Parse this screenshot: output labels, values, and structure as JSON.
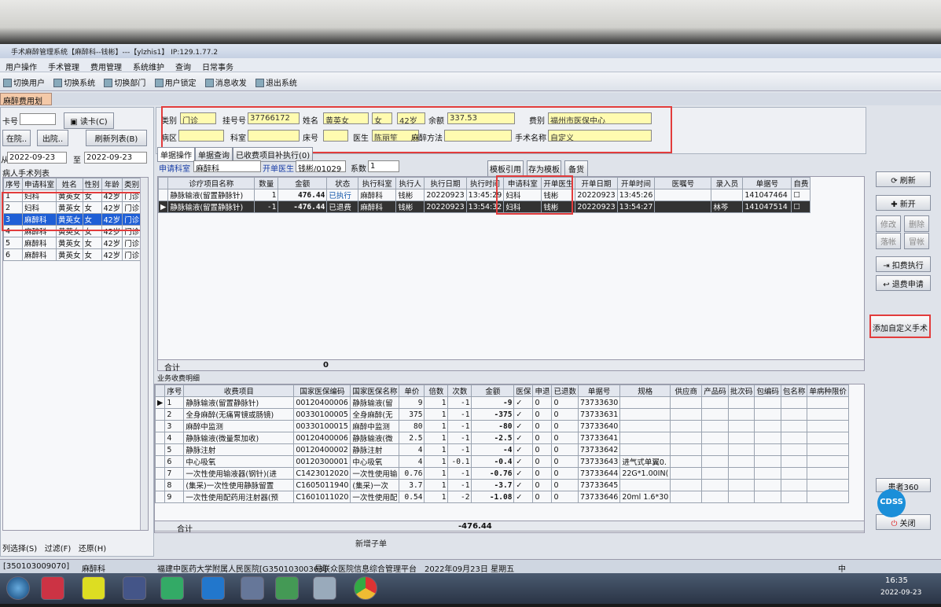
{
  "window": {
    "title": "手术麻醉管理系统【麻醉科--钱彬】---【ylzhis1】 IP:129.1.77.2"
  },
  "menu": [
    "用户操作",
    "手术管理",
    "费用管理",
    "系统维护",
    "查询",
    "日常事务"
  ],
  "toolbar": [
    "切换用户",
    "切换系统",
    "切换部门",
    "用户锁定",
    "消息收发",
    "退出系统"
  ],
  "tab": "麻醉费用划价",
  "left": {
    "card_label": "卡号",
    "read_card": "读卡(C)",
    "in_hosp": "在院..",
    "out_hosp": "出院..",
    "refresh_list": "刷新列表(B)",
    "from_label": "从",
    "date_from": "2022-09-23",
    "to_label": "至",
    "date_to": "2022-09-23",
    "list_title": "病人手术列表",
    "headers": [
      "序号",
      "申请科室",
      "姓名",
      "性别",
      "年龄",
      "类别"
    ],
    "rows": [
      [
        "1",
        "妇科",
        "黄英女",
        "女",
        "42岁",
        "门诊"
      ],
      [
        "2",
        "妇科",
        "黄英女",
        "女",
        "42岁",
        "门诊"
      ],
      [
        "3",
        "麻醉科",
        "黄英女",
        "女",
        "42岁",
        "门诊"
      ],
      [
        "4",
        "麻醉科",
        "黄英女",
        "女",
        "42岁",
        "门诊"
      ],
      [
        "5",
        "麻醉科",
        "黄英女",
        "女",
        "42岁",
        "门诊"
      ],
      [
        "6",
        "麻醉科",
        "黄英女",
        "女",
        "42岁",
        "门诊"
      ]
    ],
    "bottom": [
      "列选择(S)",
      "过滤(F)",
      "还原(H)"
    ]
  },
  "patient": {
    "type_label": "类别",
    "type_value": "门诊",
    "reg_label": "挂号号",
    "reg_value": "37766172",
    "name_label": "姓名",
    "name_value": "黄英女",
    "sex": "女",
    "age": "42岁",
    "balance_label": "余额",
    "balance_value": "337.53",
    "fee_label": "费别",
    "fee_value": "福州市医保中心",
    "ward_label": "病区",
    "dept_label": "科室",
    "bed_label": "床号",
    "doctor_label": "医生",
    "doctor_value": "陈丽笙",
    "anes_label": "麻醉方法",
    "op_label": "手术名称",
    "op_value": "自定义"
  },
  "subtabs": [
    "单据操作",
    "单据查询",
    "已收费项目补执行(0)"
  ],
  "orderbar": {
    "dept_label": "申请科室",
    "dept_value": "麻醉科",
    "doctor_label": "开单医生",
    "doctor_value": "钱彬/01029",
    "coef_label": "系数",
    "coef_value": "1",
    "template_ref": "模板引用",
    "save_template": "存为模板",
    "memo": "备货"
  },
  "orders": {
    "headers": [
      "诊疗项目名称",
      "数量",
      "金额",
      "状态",
      "执行科室",
      "执行人",
      "执行日期",
      "执行时间",
      "申请科室",
      "开单医生",
      "开单日期",
      "开单时间",
      "医嘱号",
      "录入员",
      "单据号",
      "自费"
    ],
    "rows": [
      [
        "静脉输液(留置静脉针)",
        "1",
        "476.44",
        "已执行",
        "麻醉科",
        "钱彬",
        "20220923",
        "13:45:29",
        "妇科",
        "钱彬",
        "20220923",
        "13:45:26",
        "",
        "",
        "141047464",
        ""
      ],
      [
        "静脉输液(留置静脉针)",
        "-1",
        "-476.44",
        "已退费",
        "麻醉科",
        "钱彬",
        "20220923",
        "13:54:32",
        "妇科",
        "钱彬",
        "20220923",
        "13:54:27",
        "",
        "林芩",
        "141047514",
        ""
      ]
    ],
    "total_label": "合计",
    "total_value": "0"
  },
  "right_buttons": [
    "刷新",
    "新开",
    "修改",
    "删除",
    "落帐",
    "冒帐",
    "扣费执行",
    "退费申请",
    "添加自定义手术",
    "患者360",
    "关闭"
  ],
  "fees": {
    "group_title": "业务收费明细",
    "headers": [
      "序号",
      "收费项目",
      "国家医保编码",
      "国家医保名称",
      "单价",
      "倍数",
      "次数",
      "金额",
      "医保",
      "申退",
      "已退数",
      "单据号",
      "规格",
      "供应商",
      "产品码",
      "批次码",
      "包编码",
      "包名称",
      "单病种限价"
    ],
    "rows": [
      [
        "1",
        "静脉输液(留置静脉针)",
        "00120400006",
        "静脉输液(留",
        "9",
        "1",
        "-1",
        "-9",
        "✓",
        "0",
        "0",
        "73733630",
        "",
        "",
        "",
        "",
        "",
        "",
        ""
      ],
      [
        "2",
        "全身麻醉(无痛胃镜或肠镜)",
        "00330100005",
        "全身麻醉(无",
        "375",
        "1",
        "-1",
        "-375",
        "✓",
        "0",
        "0",
        "73733631",
        "",
        "",
        "",
        "",
        "",
        "",
        ""
      ],
      [
        "3",
        "麻醉中监测",
        "00330100015",
        "麻醉中监测",
        "80",
        "1",
        "-1",
        "-80",
        "✓",
        "0",
        "0",
        "73733640",
        "",
        "",
        "",
        "",
        "",
        "",
        ""
      ],
      [
        "4",
        "静脉输液(微量泵加收)",
        "00120400006",
        "静脉输液(微",
        "2.5",
        "1",
        "-1",
        "-2.5",
        "✓",
        "0",
        "0",
        "73733641",
        "",
        "",
        "",
        "",
        "",
        "",
        ""
      ],
      [
        "5",
        "静脉注射",
        "00120400002",
        "静脉注射",
        "4",
        "1",
        "-1",
        "-4",
        "✓",
        "0",
        "0",
        "73733642",
        "",
        "",
        "",
        "",
        "",
        "",
        ""
      ],
      [
        "6",
        "中心吸氧",
        "00120300001",
        "中心吸氧",
        "4",
        "1",
        "-0.1",
        "-0.4",
        "✓",
        "0",
        "0",
        "73733643",
        "进气式单翼0.",
        "",
        "",
        "",
        "",
        "",
        ""
      ],
      [
        "7",
        "一次性使用输液器(钢针)(进",
        "C1423012020",
        "一次性使用输",
        "0.76",
        "1",
        "-1",
        "-0.76",
        "✓",
        "0",
        "0",
        "73733644",
        "22G*1.00IN(",
        "",
        "",
        "",
        "",
        "",
        ""
      ],
      [
        "8",
        "(集采)一次性使用静脉留置",
        "C1605011940",
        "(集采)一次",
        "3.7",
        "1",
        "-1",
        "-3.7",
        "✓",
        "0",
        "0",
        "73733645",
        "",
        "",
        "",
        "",
        "",
        "",
        ""
      ],
      [
        "9",
        "一次性使用配药用注射器(预",
        "C1601011020",
        "一次性使用配",
        "0.54",
        "1",
        "-2",
        "-1.08",
        "✓",
        "0",
        "0",
        "73733646",
        "20ml 1.6*30",
        "",
        "",
        "",
        "",
        "",
        ""
      ]
    ],
    "total_label": "合计",
    "total_value": "-476.44"
  },
  "status": {
    "code": "[350103009070]",
    "dept": "麻醉科",
    "hospital": "福建中医药大学附属人民医院[G35010300363]",
    "platform": "易联众医院信息综合管理平台",
    "date": "2022年09月23日 星期五"
  },
  "lower_tools": [
    "新增子单"
  ],
  "clock": {
    "time": "16:35",
    "date": "2022-09-23"
  },
  "ime": "中"
}
